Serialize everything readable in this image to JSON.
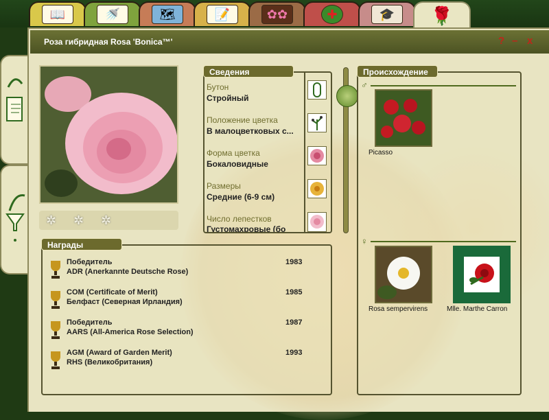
{
  "window": {
    "title": "Роза гибридная Rosa 'Bonica™'",
    "help": "?",
    "minimize": "–",
    "close": "x"
  },
  "tabs": [
    {
      "name": "book"
    },
    {
      "name": "watering-can"
    },
    {
      "name": "map"
    },
    {
      "name": "notes"
    },
    {
      "name": "gallery"
    },
    {
      "name": "health"
    },
    {
      "name": "gardener"
    },
    {
      "name": "rose"
    }
  ],
  "info": {
    "title": "Сведения",
    "items": [
      {
        "label": "Бутон",
        "value": "Стройный"
      },
      {
        "label": "Положение цветка",
        "value": "В малоцветковых с..."
      },
      {
        "label": "Форма цветка",
        "value": "Бокаловидные"
      },
      {
        "label": "Размеры",
        "value": "Средние (6-9 см)"
      },
      {
        "label": "Число лепестков",
        "value": "Густомахровые (бо"
      }
    ]
  },
  "origin": {
    "title": "Происхождение",
    "male_symbol": "♂",
    "female_symbol": "♀",
    "father": "Picasso",
    "mother1": "Rosa sempervirens",
    "mother2": "Mlle. Marthe Carron"
  },
  "awards": {
    "title": "Награды",
    "items": [
      {
        "line1": "Победитель",
        "line2": "ADR (Anerkannte Deutsche Rose)",
        "year": "1983"
      },
      {
        "line1": "COM (Certificate of Merit)",
        "line2": "Белфаст (Северная Ирландия)",
        "year": "1985"
      },
      {
        "line1": "Победитель",
        "line2": "AARS (All-America Rose Selection)",
        "year": "1987"
      },
      {
        "line1": "AGM (Award of Garden Merit)",
        "line2": "RHS (Великобритания)",
        "year": "1993"
      }
    ]
  },
  "colors": {
    "accent": "#6c6a2d",
    "window": "#e8e4c2",
    "titlebar": "#5a6029",
    "close": "#c0261a"
  }
}
